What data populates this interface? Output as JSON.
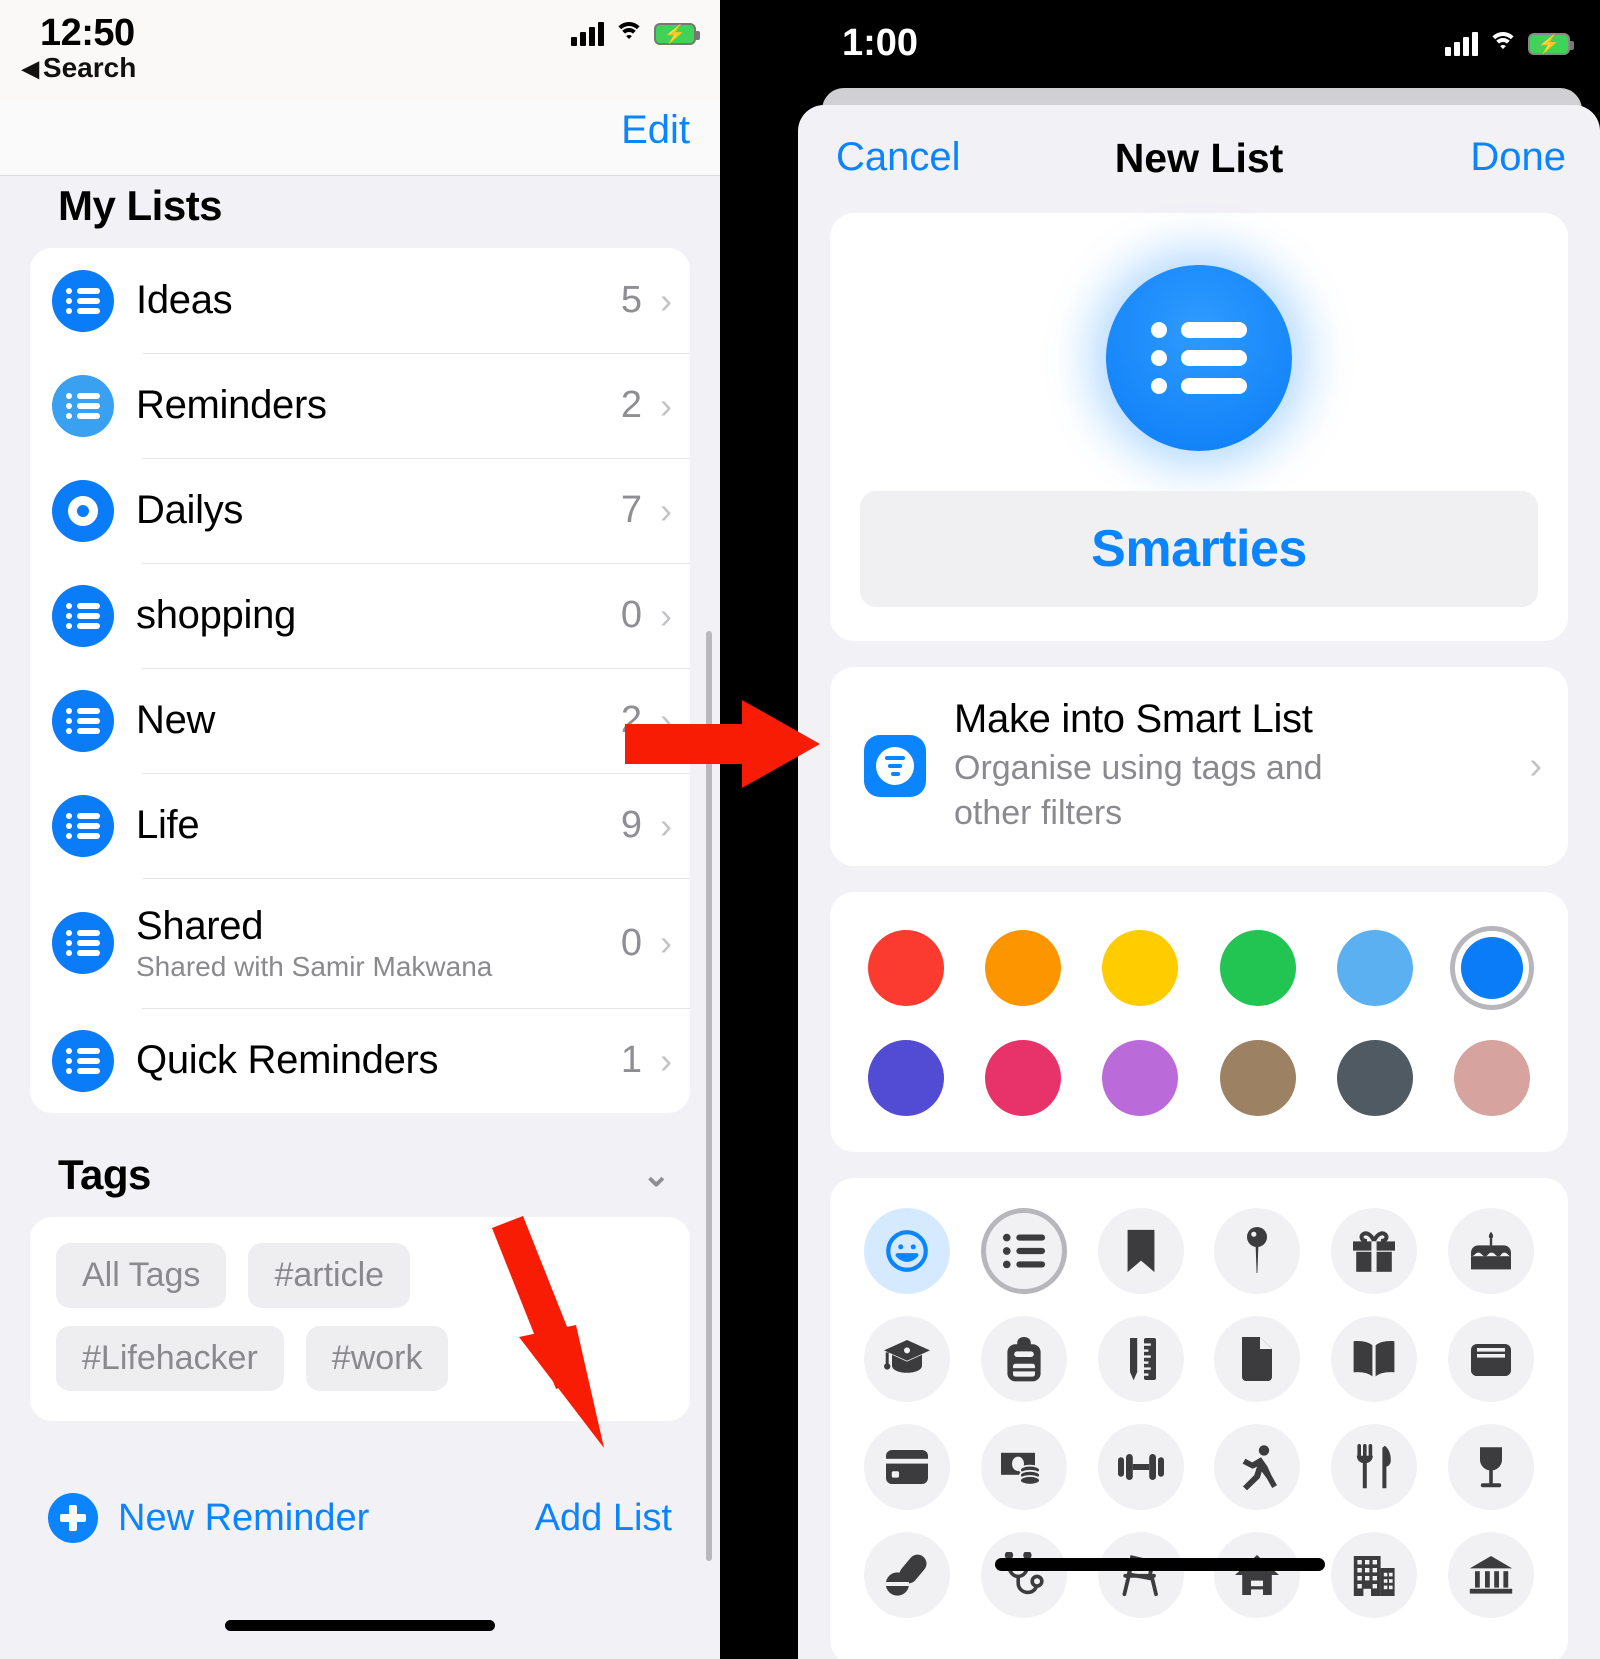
{
  "left": {
    "status": {
      "time": "12:50",
      "back_label": "Search"
    },
    "nav": {
      "edit_label": "Edit"
    },
    "my_lists": {
      "header": "My Lists",
      "items": [
        {
          "name": "Ideas",
          "count": "5",
          "icon": "list-icon",
          "color": "#0a7cf7",
          "sub": ""
        },
        {
          "name": "Reminders",
          "count": "2",
          "icon": "list-icon",
          "color": "#3aa0f0",
          "sub": ""
        },
        {
          "name": "Dailys",
          "count": "7",
          "icon": "ring-icon",
          "color": "#0a7cf7",
          "sub": ""
        },
        {
          "name": "shopping",
          "count": "0",
          "icon": "list-icon",
          "color": "#0a7cf7",
          "sub": ""
        },
        {
          "name": "New",
          "count": "2",
          "icon": "list-icon",
          "color": "#0a7cf7",
          "sub": ""
        },
        {
          "name": "Life",
          "count": "9",
          "icon": "list-icon",
          "color": "#0a7cf7",
          "sub": ""
        },
        {
          "name": "Shared",
          "count": "0",
          "icon": "list-icon",
          "color": "#0a7cf7",
          "sub": "Shared with Samir Makwana"
        },
        {
          "name": "Quick Reminders",
          "count": "1",
          "icon": "list-icon",
          "color": "#0a7cf7",
          "sub": ""
        }
      ]
    },
    "tags": {
      "header": "Tags",
      "chips": [
        "All Tags",
        "#article",
        "#Lifehacker",
        "#work"
      ]
    },
    "toolbar": {
      "new_reminder": "New Reminder",
      "add_list": "Add List"
    }
  },
  "right": {
    "status": {
      "time": "1:00"
    },
    "sheet": {
      "cancel": "Cancel",
      "title": "New List",
      "done": "Done",
      "name_value": "Smarties",
      "smart": {
        "title": "Make into Smart List",
        "subtitle": "Organise using tags and other filters"
      },
      "colors": [
        {
          "hex": "#fb3b30",
          "selected": false
        },
        {
          "hex": "#fd9500",
          "selected": false
        },
        {
          "hex": "#ffcc00",
          "selected": false
        },
        {
          "hex": "#22c552",
          "selected": false
        },
        {
          "hex": "#5ab0f0",
          "selected": false
        },
        {
          "hex": "#0a7cf7",
          "selected": true
        },
        {
          "hex": "#524bd3",
          "selected": false
        },
        {
          "hex": "#e8336a",
          "selected": false
        },
        {
          "hex": "#bb6bd9",
          "selected": false
        },
        {
          "hex": "#9c8263",
          "selected": false
        },
        {
          "hex": "#4f5a62",
          "selected": false
        },
        {
          "hex": "#d6a39e",
          "selected": false
        }
      ],
      "icons": [
        {
          "name": "smiley-icon",
          "state": "active"
        },
        {
          "name": "list-icon",
          "state": "selected"
        },
        {
          "name": "bookmark-icon",
          "state": "normal"
        },
        {
          "name": "pin-icon",
          "state": "normal"
        },
        {
          "name": "gift-icon",
          "state": "normal"
        },
        {
          "name": "birthday-cake-icon",
          "state": "normal"
        },
        {
          "name": "graduation-cap-icon",
          "state": "normal"
        },
        {
          "name": "backpack-icon",
          "state": "normal"
        },
        {
          "name": "pencil-ruler-icon",
          "state": "normal"
        },
        {
          "name": "document-icon",
          "state": "normal"
        },
        {
          "name": "book-icon",
          "state": "normal"
        },
        {
          "name": "wallet-icon",
          "state": "normal"
        },
        {
          "name": "credit-card-icon",
          "state": "normal"
        },
        {
          "name": "cash-icon",
          "state": "normal"
        },
        {
          "name": "dumbbell-icon",
          "state": "normal"
        },
        {
          "name": "running-person-icon",
          "state": "normal"
        },
        {
          "name": "fork-knife-icon",
          "state": "normal"
        },
        {
          "name": "wine-glass-icon",
          "state": "normal"
        },
        {
          "name": "pills-icon",
          "state": "normal"
        },
        {
          "name": "stethoscope-icon",
          "state": "normal"
        },
        {
          "name": "chair-icon",
          "state": "normal"
        },
        {
          "name": "house-icon",
          "state": "normal"
        },
        {
          "name": "building-icon",
          "state": "normal"
        },
        {
          "name": "bank-icon",
          "state": "normal"
        }
      ]
    }
  },
  "annotations": {
    "arrow_color": "#f91c05"
  }
}
